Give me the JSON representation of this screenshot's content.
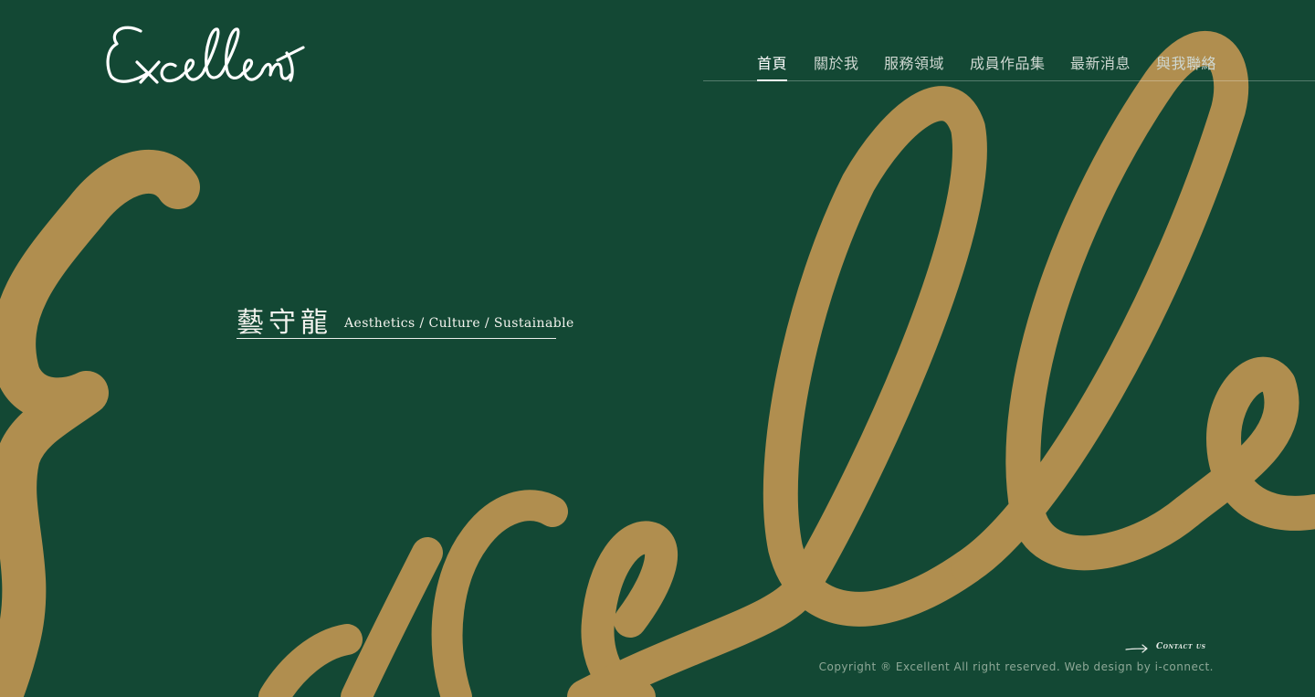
{
  "brand": {
    "logo_text": "Excellent"
  },
  "nav": {
    "items": [
      {
        "label": "首頁",
        "active": true
      },
      {
        "label": "關於我",
        "active": false
      },
      {
        "label": "服務領域",
        "active": false
      },
      {
        "label": "成員作品集",
        "active": false
      },
      {
        "label": "最新消息",
        "active": false
      },
      {
        "label": "與我聯絡",
        "active": false
      }
    ]
  },
  "hero": {
    "title_cn": "藝守龍",
    "subtitle_en": "Aesthetics / Culture / Sustainable"
  },
  "footer": {
    "contact_label": "Contact us",
    "copyright": "Copyright ® Excellent All right reserved. Web design by i-connect."
  },
  "colors": {
    "background": "#134834",
    "script_gold": "#b08e4f",
    "text_white": "#ffffff",
    "copyright_gray": "#8ea897"
  },
  "icons": {
    "contact_arrow": "long-right-arrow-icon"
  }
}
